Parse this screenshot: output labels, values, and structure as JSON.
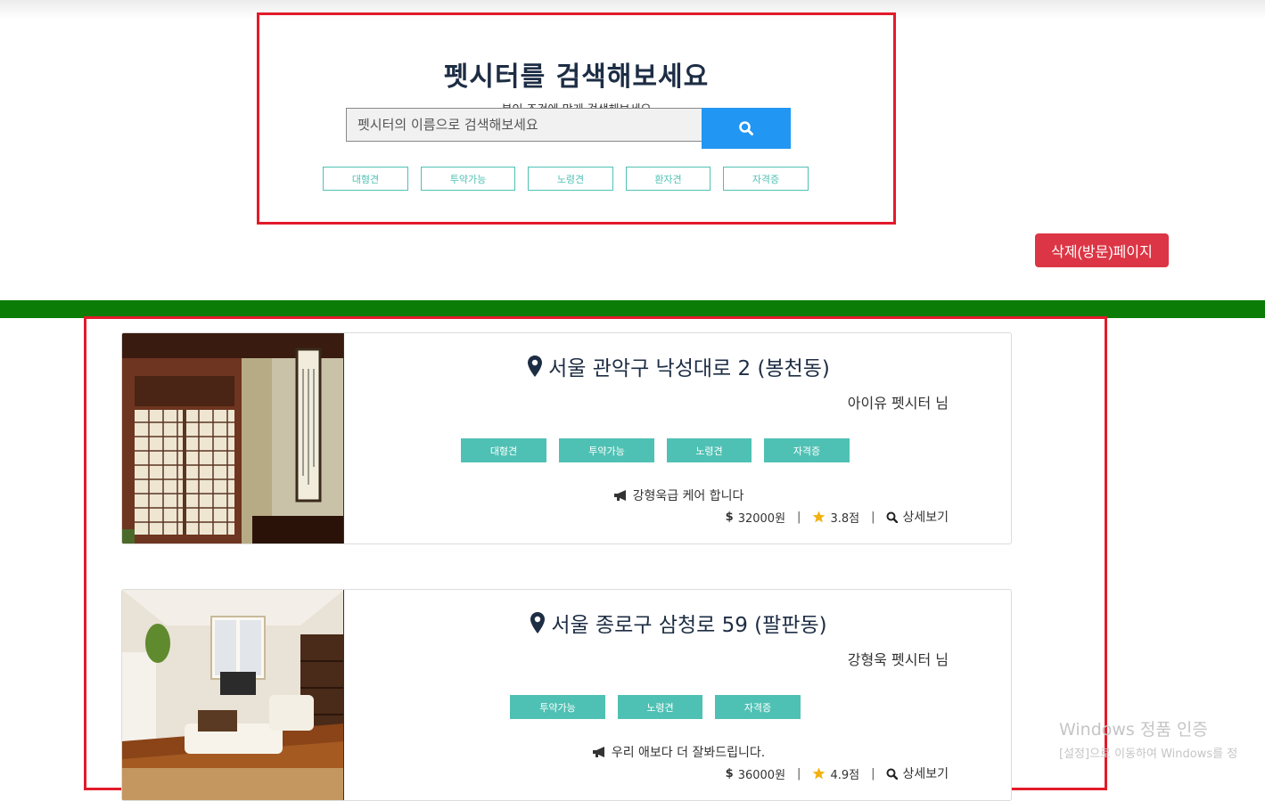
{
  "search": {
    "title": "펫시터를 검색해보세요",
    "subtitle": "본인 조건에 맞게 검색해보세요",
    "placeholder": "펫시터의 이름으로 검색해보세요",
    "button_icon": "search-icon",
    "tags": [
      "대형견",
      "투약가능",
      "노령견",
      "환자견",
      "자격증"
    ]
  },
  "delete_button": "삭제(방문)페이지",
  "colors": {
    "accent_red": "#e21b2a",
    "green_bar": "#0b7d06",
    "tag_teal": "#4fc1b4",
    "search_blue": "#2196f3",
    "delete_red": "#dc3545",
    "text_navy": "#1d2d44"
  },
  "results": [
    {
      "address": "서울 관악구 낙성대로 2 (봉천동)",
      "sitter": "아이유 펫시터 님",
      "tags": [
        "대형견",
        "투약가능",
        "노령견",
        "자격증"
      ],
      "message": "강형욱급 케어 합니다",
      "price": "32000원",
      "rating": "3.8점",
      "detail": "상세보기",
      "image": "japanese-room-photo"
    },
    {
      "address": "서울 종로구 삼청로 59 (팔판동)",
      "sitter": "강형욱 펫시터 님",
      "tags": [
        "투약가능",
        "노령견",
        "자격증"
      ],
      "message": "우리 애보다 더 잘봐드립니다.",
      "price": "36000원",
      "rating": "4.9점",
      "detail": "상세보기",
      "image": "living-room-photo"
    }
  ],
  "watermark": {
    "line1": "Windows 정품 인증",
    "line2": "[설정]으로 이동하여 Windows를 정"
  }
}
